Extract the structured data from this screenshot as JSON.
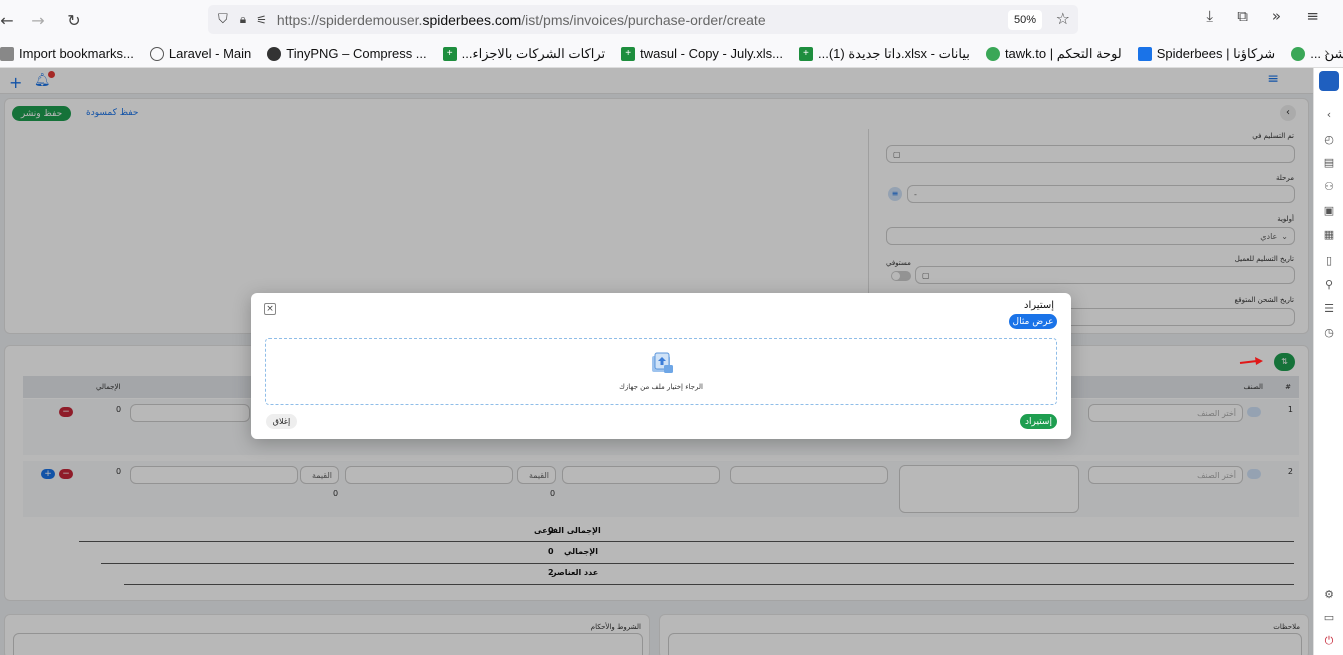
{
  "browser": {
    "url_prefix": "https://spiderdemouser.",
    "url_host": "spiderbees.com",
    "url_path": "/ist/pms/invoices/purchase-order/create",
    "zoom": "50%",
    "back_icon": "arrow-left-icon",
    "forward_icon": "arrow-right-icon",
    "reload_icon": "reload-icon"
  },
  "bookmarks": [
    {
      "label": "Import bookmarks...",
      "icon": "import-icon"
    },
    {
      "label": "Laravel - Main",
      "icon": "globe-icon"
    },
    {
      "label": "TinyPNG – Compress ...",
      "icon": "panda-icon"
    },
    {
      "label": "...تراكات الشركات بالاجزاء",
      "icon": "sheets-icon"
    },
    {
      "label": "twasul - Copy - July.xls...",
      "icon": "sheets-icon"
    },
    {
      "label": "...داتا جديدة (1).xlsx - بيانات",
      "icon": "sheets-icon"
    },
    {
      "label": "tawk.to | لوحة التحكم",
      "icon": "tawk-icon"
    },
    {
      "label": "Spiderbees | شركاؤنا",
      "icon": "spiderbees-icon"
    },
    {
      "label": "... الحمراء – اورجانيك نيشن",
      "icon": "leaf-icon"
    }
  ],
  "page": {
    "save_publish": "حفظ ونشر",
    "save_draft": "حفظ كمسودة",
    "fields": {
      "delivered_on": "تم التسليم في",
      "stage": "مرحلة",
      "stage_value": "-",
      "priority": "أولوية",
      "priority_value": "عادي",
      "customer_delivery_date": "تاريخ التسليم للعميل",
      "completed": "مستوفي",
      "expected_ship_date": "تاريخ الشحن المتوقع"
    },
    "table": {
      "col_total": "الإجمالي",
      "col_item": "الصنف",
      "col_num": "#",
      "rows": [
        {
          "num": "1",
          "select_placeholder": "أختر الصنف",
          "total": "0"
        },
        {
          "num": "2",
          "select_placeholder": "أختر الصنف",
          "total": "0",
          "value_placeholder_1": "القيمة",
          "value_placeholder_2": "القيمة",
          "sub_val_1": "0",
          "sub_val_2": "0"
        }
      ]
    },
    "summary": [
      {
        "label": "الإجمالى الفرعى",
        "value": "0"
      },
      {
        "label": "الإجمالي",
        "value": "0"
      },
      {
        "label": "عدد العناصر",
        "value": "2"
      }
    ],
    "terms": "الشروط والأحكام",
    "notes": "ملاحظات"
  },
  "modal": {
    "title": "إستيراد",
    "show_example": "عرض مثال",
    "drop_text": "الرجاء إختيار ملف من جهازك",
    "import_button": "إستيراد",
    "close_button": "إغلاق"
  },
  "colors": {
    "green": "#1e9e50",
    "blue": "#1a73e8",
    "red": "#c62839",
    "arrow": "#e01818"
  }
}
